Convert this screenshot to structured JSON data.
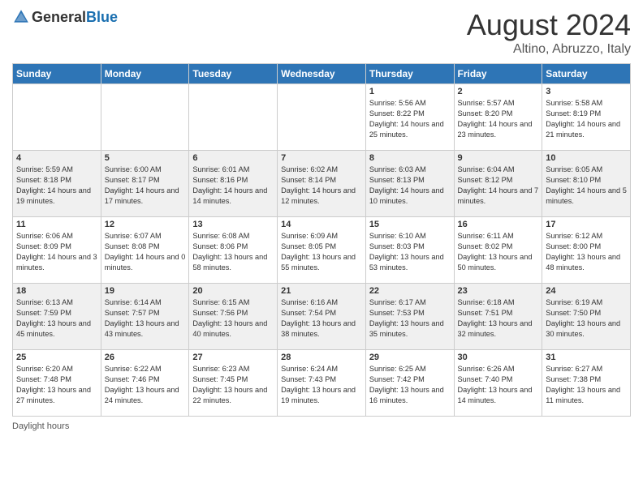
{
  "header": {
    "logo_general": "General",
    "logo_blue": "Blue",
    "month": "August 2024",
    "location": "Altino, Abruzzo, Italy"
  },
  "days_of_week": [
    "Sunday",
    "Monday",
    "Tuesday",
    "Wednesday",
    "Thursday",
    "Friday",
    "Saturday"
  ],
  "footer": {
    "daylight_label": "Daylight hours"
  },
  "weeks": [
    [
      {
        "day": "",
        "info": ""
      },
      {
        "day": "",
        "info": ""
      },
      {
        "day": "",
        "info": ""
      },
      {
        "day": "",
        "info": ""
      },
      {
        "day": "1",
        "info": "Sunrise: 5:56 AM\nSunset: 8:22 PM\nDaylight: 14 hours and 25 minutes."
      },
      {
        "day": "2",
        "info": "Sunrise: 5:57 AM\nSunset: 8:20 PM\nDaylight: 14 hours and 23 minutes."
      },
      {
        "day": "3",
        "info": "Sunrise: 5:58 AM\nSunset: 8:19 PM\nDaylight: 14 hours and 21 minutes."
      }
    ],
    [
      {
        "day": "4",
        "info": "Sunrise: 5:59 AM\nSunset: 8:18 PM\nDaylight: 14 hours and 19 minutes."
      },
      {
        "day": "5",
        "info": "Sunrise: 6:00 AM\nSunset: 8:17 PM\nDaylight: 14 hours and 17 minutes."
      },
      {
        "day": "6",
        "info": "Sunrise: 6:01 AM\nSunset: 8:16 PM\nDaylight: 14 hours and 14 minutes."
      },
      {
        "day": "7",
        "info": "Sunrise: 6:02 AM\nSunset: 8:14 PM\nDaylight: 14 hours and 12 minutes."
      },
      {
        "day": "8",
        "info": "Sunrise: 6:03 AM\nSunset: 8:13 PM\nDaylight: 14 hours and 10 minutes."
      },
      {
        "day": "9",
        "info": "Sunrise: 6:04 AM\nSunset: 8:12 PM\nDaylight: 14 hours and 7 minutes."
      },
      {
        "day": "10",
        "info": "Sunrise: 6:05 AM\nSunset: 8:10 PM\nDaylight: 14 hours and 5 minutes."
      }
    ],
    [
      {
        "day": "11",
        "info": "Sunrise: 6:06 AM\nSunset: 8:09 PM\nDaylight: 14 hours and 3 minutes."
      },
      {
        "day": "12",
        "info": "Sunrise: 6:07 AM\nSunset: 8:08 PM\nDaylight: 14 hours and 0 minutes."
      },
      {
        "day": "13",
        "info": "Sunrise: 6:08 AM\nSunset: 8:06 PM\nDaylight: 13 hours and 58 minutes."
      },
      {
        "day": "14",
        "info": "Sunrise: 6:09 AM\nSunset: 8:05 PM\nDaylight: 13 hours and 55 minutes."
      },
      {
        "day": "15",
        "info": "Sunrise: 6:10 AM\nSunset: 8:03 PM\nDaylight: 13 hours and 53 minutes."
      },
      {
        "day": "16",
        "info": "Sunrise: 6:11 AM\nSunset: 8:02 PM\nDaylight: 13 hours and 50 minutes."
      },
      {
        "day": "17",
        "info": "Sunrise: 6:12 AM\nSunset: 8:00 PM\nDaylight: 13 hours and 48 minutes."
      }
    ],
    [
      {
        "day": "18",
        "info": "Sunrise: 6:13 AM\nSunset: 7:59 PM\nDaylight: 13 hours and 45 minutes."
      },
      {
        "day": "19",
        "info": "Sunrise: 6:14 AM\nSunset: 7:57 PM\nDaylight: 13 hours and 43 minutes."
      },
      {
        "day": "20",
        "info": "Sunrise: 6:15 AM\nSunset: 7:56 PM\nDaylight: 13 hours and 40 minutes."
      },
      {
        "day": "21",
        "info": "Sunrise: 6:16 AM\nSunset: 7:54 PM\nDaylight: 13 hours and 38 minutes."
      },
      {
        "day": "22",
        "info": "Sunrise: 6:17 AM\nSunset: 7:53 PM\nDaylight: 13 hours and 35 minutes."
      },
      {
        "day": "23",
        "info": "Sunrise: 6:18 AM\nSunset: 7:51 PM\nDaylight: 13 hours and 32 minutes."
      },
      {
        "day": "24",
        "info": "Sunrise: 6:19 AM\nSunset: 7:50 PM\nDaylight: 13 hours and 30 minutes."
      }
    ],
    [
      {
        "day": "25",
        "info": "Sunrise: 6:20 AM\nSunset: 7:48 PM\nDaylight: 13 hours and 27 minutes."
      },
      {
        "day": "26",
        "info": "Sunrise: 6:22 AM\nSunset: 7:46 PM\nDaylight: 13 hours and 24 minutes."
      },
      {
        "day": "27",
        "info": "Sunrise: 6:23 AM\nSunset: 7:45 PM\nDaylight: 13 hours and 22 minutes."
      },
      {
        "day": "28",
        "info": "Sunrise: 6:24 AM\nSunset: 7:43 PM\nDaylight: 13 hours and 19 minutes."
      },
      {
        "day": "29",
        "info": "Sunrise: 6:25 AM\nSunset: 7:42 PM\nDaylight: 13 hours and 16 minutes."
      },
      {
        "day": "30",
        "info": "Sunrise: 6:26 AM\nSunset: 7:40 PM\nDaylight: 13 hours and 14 minutes."
      },
      {
        "day": "31",
        "info": "Sunrise: 6:27 AM\nSunset: 7:38 PM\nDaylight: 13 hours and 11 minutes."
      }
    ]
  ]
}
